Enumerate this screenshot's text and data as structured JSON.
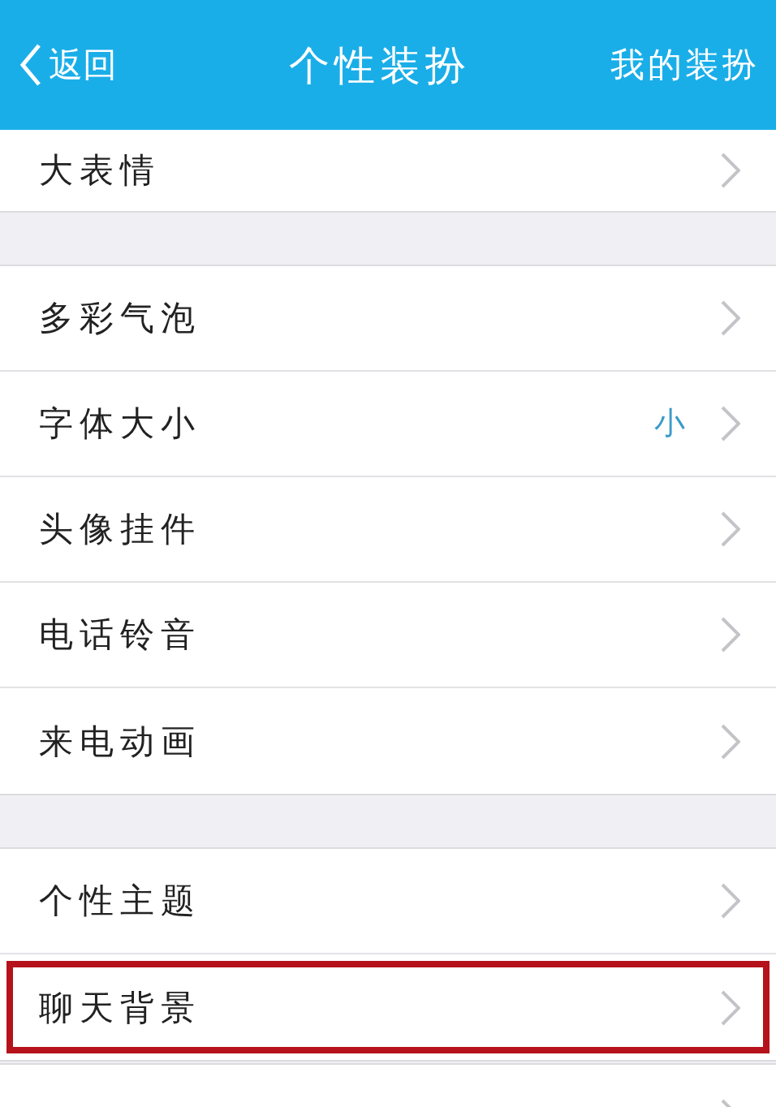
{
  "nav_bar": {
    "back": "返回",
    "title": "个性装扮",
    "action": "我的装扮"
  },
  "sections": [
    {
      "items": [
        {
          "label": "大表情",
          "highlighted": false
        }
      ]
    },
    {
      "items": [
        {
          "label": "多彩气泡",
          "highlighted": false
        },
        {
          "label": "字体大小",
          "value": "小",
          "highlighted": false
        },
        {
          "label": "头像挂件",
          "highlighted": false
        },
        {
          "label": "电话铃音",
          "highlighted": false
        },
        {
          "label": "来电动画",
          "highlighted": false
        }
      ]
    },
    {
      "items": [
        {
          "label": "个性主题",
          "highlighted": false
        },
        {
          "label": "聊天背景",
          "highlighted": true
        }
      ]
    }
  ]
}
